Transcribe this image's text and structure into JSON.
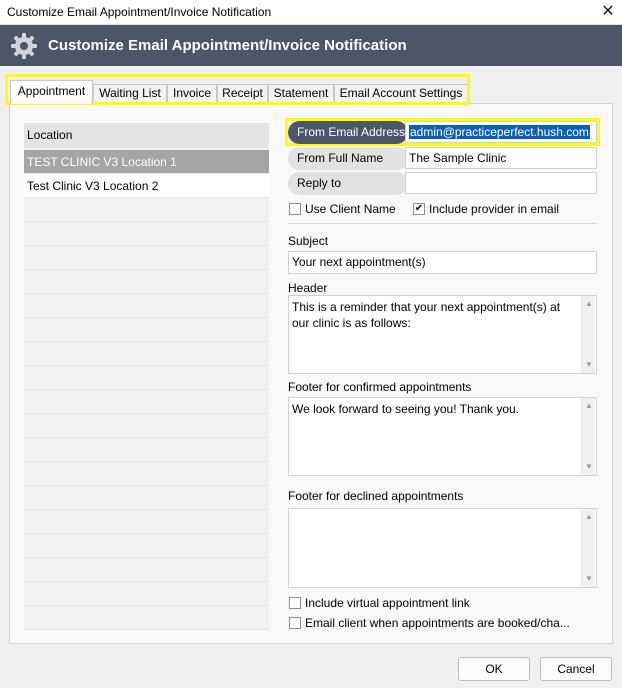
{
  "window": {
    "title": "Customize Email Appointment/Invoice Notification",
    "close_glyph": "✕"
  },
  "header": {
    "icon": "gear-icon",
    "title": "Customize Email Appointment/Invoice Notification"
  },
  "tabs": [
    {
      "label": "Appointment",
      "active": true
    },
    {
      "label": "Waiting List",
      "active": false
    },
    {
      "label": "Invoice",
      "active": false
    },
    {
      "label": "Receipt",
      "active": false
    },
    {
      "label": "Statement",
      "active": false
    },
    {
      "label": "Email Account Settings",
      "active": false
    }
  ],
  "locations": {
    "header": "Location",
    "items": [
      {
        "label": "TEST CLINIC V3 Location 1",
        "selected": true
      },
      {
        "label": "Test Clinic V3 Location 2",
        "selected": false
      }
    ]
  },
  "form": {
    "from_email": {
      "label": "From Email Address",
      "value": "admin@practiceperfect.hush.com"
    },
    "from_name": {
      "label": "From Full Name",
      "value": "The Sample Clinic"
    },
    "reply_to": {
      "label": "Reply to",
      "value": ""
    },
    "use_client_name": {
      "label": "Use Client Name",
      "checked": false
    },
    "include_provider": {
      "label": "Include provider in email",
      "checked": true
    },
    "subject": {
      "label": "Subject",
      "value": "Your next appointment(s)"
    },
    "header_text": {
      "label": "Header",
      "value": "This is a reminder that your next appointment(s) at our clinic is as follows:"
    },
    "footer_confirmed": {
      "label": "Footer for confirmed appointments",
      "value": "We look forward to seeing you! Thank you."
    },
    "footer_declined": {
      "label": "Footer for declined appointments",
      "value": ""
    },
    "include_virtual_link": {
      "label": "Include virtual appointment link",
      "checked": false
    },
    "email_client_when_booked": {
      "label": "Email client when appointments are booked/cha...",
      "checked": false
    }
  },
  "buttons": {
    "ok": "OK",
    "cancel": "Cancel"
  },
  "colors": {
    "header_bg": "#4b5769",
    "highlight": "#ffff00",
    "selection": "#0b5fb6",
    "selected_row": "#a5a5a8"
  }
}
